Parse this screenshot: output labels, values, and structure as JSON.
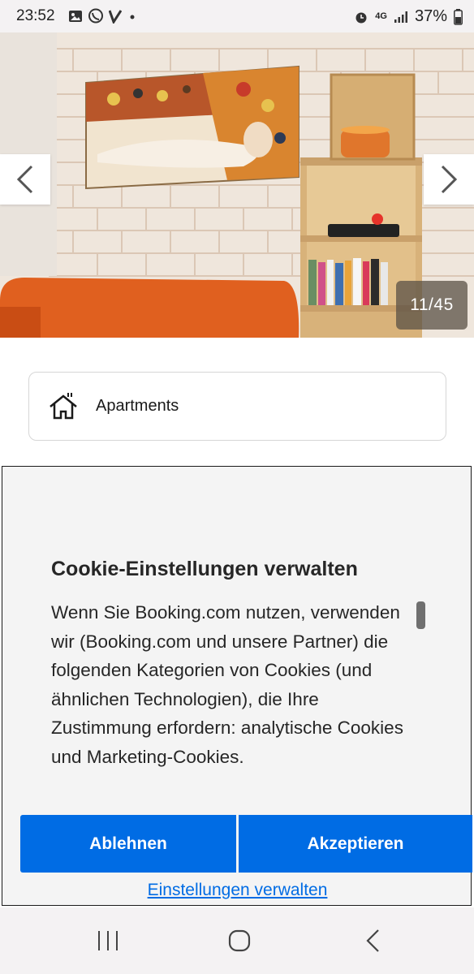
{
  "status_bar": {
    "time": "23:52",
    "network": "4G",
    "battery": "37%",
    "icons": [
      "image-icon",
      "viber-icon",
      "v-app-icon",
      "dot-icon",
      "alarm-icon",
      "signal-icon",
      "battery-icon"
    ]
  },
  "gallery": {
    "counter": "11/45",
    "prev_icon": "chevron-left-icon",
    "next_icon": "chevron-right-icon"
  },
  "property": {
    "type_label": "Apartments",
    "type_icon": "house-icon"
  },
  "cookie_dialog": {
    "title": "Cookie-Einstellungen verwalten",
    "body": "Wenn Sie Booking.com nutzen, verwenden wir (Booking.com und unsere Partner) die folgenden Kategorien von Cookies (und ähnlichen Technologien), die Ihre Zustimmung erfordern: analytische Cookies und Marketing-Cookies.",
    "decline_label": "Ablehnen",
    "accept_label": "Akzeptieren",
    "manage_label": "Einstellungen verwalten"
  },
  "colors": {
    "primary": "#006ce4",
    "dialog_bg": "#f4f4f4"
  },
  "nav_bar": {
    "icons": [
      "recent-apps-icon",
      "home-icon",
      "back-icon"
    ]
  }
}
